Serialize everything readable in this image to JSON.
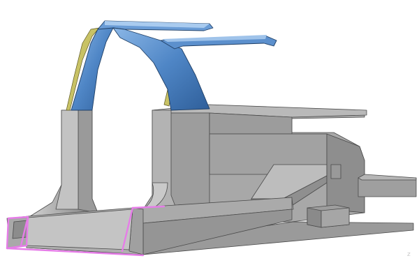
{
  "viewport": {
    "background": "#ffffff",
    "axis_label": "z"
  },
  "model": {
    "type": "3d-cad-assembly",
    "view": "isometric",
    "components": [
      {
        "name": "body-side-sill-structure",
        "color": "#a3a3a3",
        "visible": true
      },
      {
        "name": "roof-pillar-arch",
        "color": "#4f86c6",
        "visible": true
      },
      {
        "name": "inner-reinforcement-layer",
        "color": "#c8c265",
        "visible": true
      },
      {
        "name": "selected-edge-highlight",
        "color": "#e67de8",
        "visible": true
      }
    ]
  }
}
